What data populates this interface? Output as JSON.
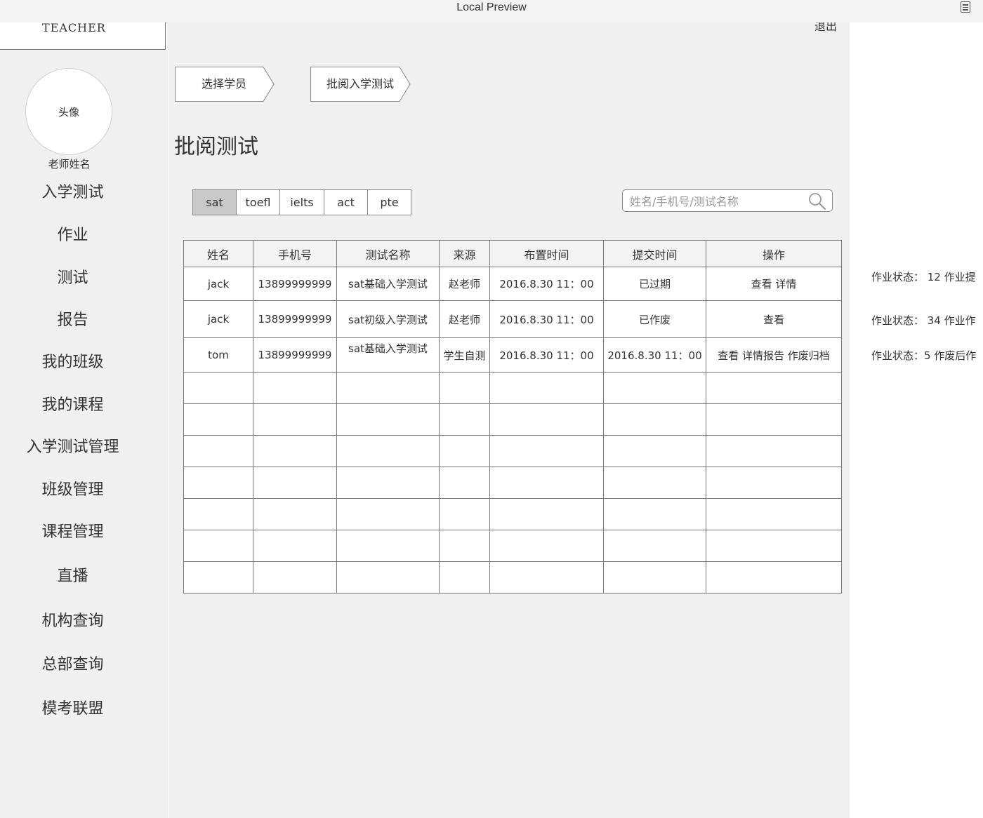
{
  "window": {
    "title": "Local Preview",
    "menu_icon": "document-list-icon"
  },
  "header": {
    "logo_text": "TEACHER",
    "logout_label": "退出"
  },
  "sidebar": {
    "avatar_label": "头像",
    "teacher_name": "老师姓名",
    "items": [
      {
        "label": "入学测试"
      },
      {
        "label": "作业"
      },
      {
        "label": "测试"
      },
      {
        "label": "报告"
      },
      {
        "label": "我的班级"
      },
      {
        "label": "我的课程"
      },
      {
        "label": "入学测试管理"
      },
      {
        "label": "班级管理"
      },
      {
        "label": "课程管理"
      },
      {
        "label": "直播"
      },
      {
        "label": "机构查询"
      },
      {
        "label": "总部查询"
      },
      {
        "label": "模考联盟"
      }
    ]
  },
  "steps": [
    {
      "label": "选择学员"
    },
    {
      "label": "批阅入学测试"
    }
  ],
  "main": {
    "title": "批阅测试"
  },
  "tabs": {
    "active": "sat",
    "items": [
      {
        "label": "sat"
      },
      {
        "label": "toefl"
      },
      {
        "label": "ielts"
      },
      {
        "label": "act"
      },
      {
        "label": "pte"
      }
    ]
  },
  "search": {
    "placeholder": "姓名/手机号/测试名称",
    "icon": "search-icon"
  },
  "table": {
    "headers": [
      "姓名",
      "手机号",
      "测试名称",
      "来源",
      "布置时间",
      "提交时间",
      "操作"
    ],
    "rows": [
      {
        "name": "jack",
        "phone": "13899999999",
        "test": "sat基础入学测试",
        "source": "赵老师",
        "assigned": "2016.8.30 11：00",
        "submitted": "已过期",
        "actions": [
          "查看",
          "详情"
        ]
      },
      {
        "name": "jack",
        "phone": "13899999999",
        "test": "sat初级入学测试",
        "source": "赵老师",
        "assigned": "2016.8.30 11：00",
        "submitted": "已作废",
        "actions": [
          "查看"
        ]
      },
      {
        "name": "tom",
        "phone": "13899999999",
        "test": "sat基础入学测试",
        "source": "学生自测",
        "assigned": "2016.8.30 11：00",
        "submitted": "2016.8.30 11：00",
        "actions": [
          "查看",
          "详情报告",
          "作废归档"
        ]
      }
    ],
    "empty_rows": 7
  },
  "notes": [
    {
      "text": "作业状态： 12  作业提"
    },
    {
      "text": "作业状态： 34   作业作"
    },
    {
      "text": "作业状态：5   作废后作"
    }
  ]
}
